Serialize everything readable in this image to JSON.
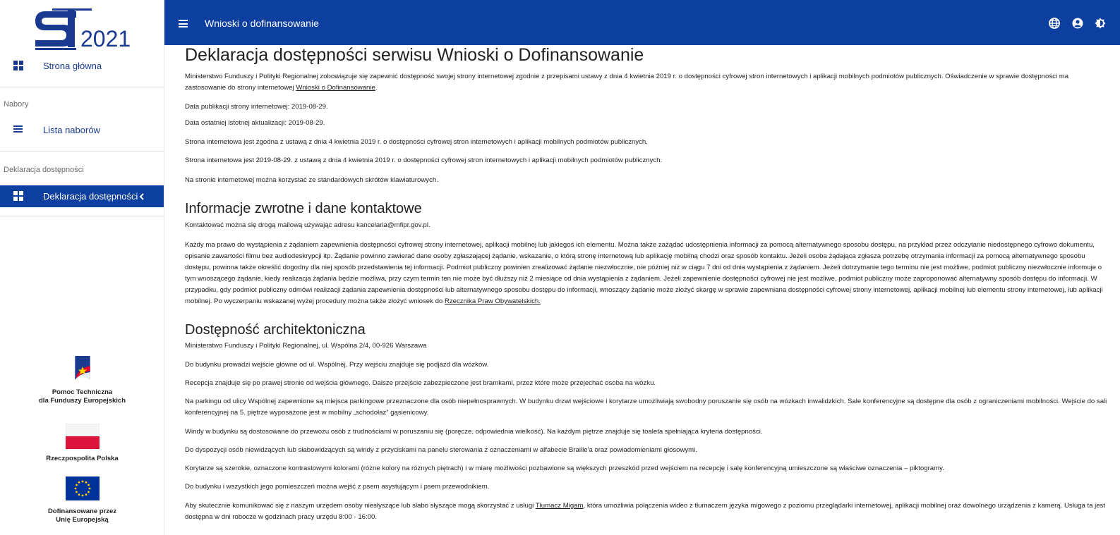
{
  "sidebar": {
    "logo_text": "2021",
    "nav": {
      "home": "Strona główna",
      "nabory_section": "Nabory",
      "lista_naborow": "Lista naborów",
      "deklaracja_section": "Deklaracja dostępności",
      "deklaracja_item": "Deklaracja dostępności"
    },
    "partners": [
      {
        "name_line1": "Pomoc Techniczna",
        "name_line2": "dla Funduszy Europejskich"
      },
      {
        "name_line1": "Rzeczpospolita Polska",
        "name_line2": ""
      },
      {
        "name_line1": "Dofinansowane przez",
        "name_line2": "Unię Europejską"
      }
    ]
  },
  "topbar": {
    "title": "Wnioski o dofinansowanie",
    "icons": [
      "globe-icon",
      "user-icon",
      "contrast-icon"
    ]
  },
  "colors": {
    "brand_blue": "#0d3fa0",
    "nav_text": "#1a3a8f"
  },
  "content": {
    "title": "Deklaracja dostępności serwisu Wnioski o Dofinansowanie",
    "intro_text": "Ministerstwo Funduszy i Polityki Regionalnej zobowiązuje się zapewnić dostępność swojej strony internetowej zgodnie z przepisami ustawy z dnia 4 kwietnia 2019 r. o dostępności cyfrowej stron internetowych i aplikacji mobilnych podmiotów publicznych. Oświadczenie w sprawie dostępności ma zastosowanie do strony internetowej ",
    "intro_link": "Wnioski o Dofinansowanie",
    "publication_date": "Data publikacji strony internetowej: 2019-08-29.",
    "update_date": "Data ostatniej istotnej aktualizacji: 2019-08-29.",
    "compliance": "Strona internetowa jest zgodna z ustawą z dnia 4 kwietnia 2019 r. o dostępności cyfrowej stron internetowych i aplikacji mobilnych podmiotów publicznych.",
    "compliance2": "Strona internetowa jest 2019-08-29. z ustawą z dnia 4 kwietnia 2019 r. o dostępności cyfrowej stron internetowych i aplikacji mobilnych podmiotów publicznych.",
    "shortcuts": "Na stronie internetowej można korzystać ze standardowych skrótów klawiaturowych.",
    "feedback_title": "Informacje zwrotne i dane kontaktowe",
    "contact": "Kontaktować można się drogą mailową używając adresu kancelaria@mfipr.gov.pl.",
    "rights_text": "Każdy ma prawo do wystąpienia z żądaniem zapewnienia dostępności cyfrowej strony internetowej, aplikacji mobilnej lub jakiegoś ich elementu. Można także zażądać udostępnienia informacji za pomocą alternatywnego sposobu dostępu, na przykład przez odczytanie niedostępnego cyfrowo dokumentu, opisanie zawartości filmu bez audiodeskrypcji itp. Żądanie powinno zawierać dane osoby zgłaszającej żądanie, wskazanie, o którą stronę internetową lub aplikację mobilną chodzi oraz sposób kontaktu. Jeżeli osoba żądająca zgłasza potrzebę otrzymania informacji za pomocą alternatywnego sposobu dostępu, powinna także określić dogodny dla niej sposób przedstawienia tej informacji. Podmiot publiczny powinien zrealizować żądanie niezwłocznie, nie później niż w ciągu 7 dni od dnia wystąpienia z żądaniem. Jeżeli dotrzymanie tego terminu nie jest możliwe, podmiot publiczny niezwłocznie informuje o tym wnoszącego żądanie, kiedy realizacja żądania będzie możliwa, przy czym termin ten nie może być dłuższy niż 2 miesiące od dnia wystąpienia z żądaniem. Jeżeli zapewnienie dostępności cyfrowej nie jest możliwe, podmiot publiczny może zaproponować alternatywny sposób dostępu do informacji. W przypadku, gdy podmiot publiczny odmówi realizacji żądania zapewnienia dostępności lub alternatywnego sposobu dostępu do informacji, wnoszący żądanie może złożyć skargę w sprawie zapewniana dostępności cyfrowej strony internetowej, aplikacji mobilnej lub elementu strony internetowej, lub aplikacji mobilnej. Po wyczerpaniu wskazanej wyżej procedury można także złożyć wniosek do ",
    "rights_link": "Rzecznika Praw Obywatelskich.",
    "arch_title": "Dostępność architektoniczna",
    "address": "Ministerstwo Funduszy i Polityki Regionalnej, ul. Wspólna 2/4, 00-926 Warszawa",
    "arch_p1": "Do budynku prowadzi wejście główne od ul. Wspólnej. Przy wejściu znajduje się podjazd dla wózków.",
    "arch_p2": "Recepcja znajduje się po prawej stronie od wejścia głównego. Dalsze przejście zabezpieczone jest bramkami, przez które może przejechać osoba na wózku.",
    "arch_p3": "Na parkingu od ulicy Wspólnej zapewnione są miejsca parkingowe przeznaczone dla osób niepełnosprawnych. W budynku drzwi wejściowe i korytarze umożliwiają swobodny poruszanie się osób na wózkach inwalidzkich. Sale konferencyjne są dostępne dla osób z ograniczeniami mobilności. Wejście do sali konferencyjnej na 5. piętrze wyposażone jest w mobilny „schodołaz” gąsienicowy.",
    "arch_p4": "Windy w budynku są dostosowane do przewozu osób z trudnościami w poruszaniu się (poręcze, odpowiednia wielkość). Na każdym piętrze znajduje się toaleta spełniająca kryteria dostępności.",
    "arch_p5": "Do dyspozycji osób niewidzących lub słabowidzących są windy z przyciskami na panelu sterowania z oznaczeniami w alfabecie Braille'a oraz powiadomieniami głosowymi.",
    "arch_p6": "Korytarze są szerokie, oznaczone kontrastowymi kolorami (różne kolory na różnych piętrach) i w miarę możliwości pozbawione są większych przeszkód przed wejściem na recepcję i salę konferencyjną umieszczone są właściwe oznaczenia – piktogramy.",
    "arch_p7": "Do budynku i wszystkich jego pomieszczeń można wejść z psem asystującym i psem przewodnikiem.",
    "arch_p8_pre": "Aby skutecznie komunikować się z naszym urzędem osoby niesłyszące lub słabo słyszące mogą skorzystać z usługi ",
    "arch_p8_link": "Tłumacz Migam",
    "arch_p8_post": ", która umożliwia połączenia wideo z tłumaczem języka migowego z poziomu przeglądarki internetowej, aplikacji mobilnej oraz dowolnego urządzenia z kamerą. Usługa ta jest dostępna w dni robocze w godzinach pracy urzędu 8:00 - 16:00."
  }
}
